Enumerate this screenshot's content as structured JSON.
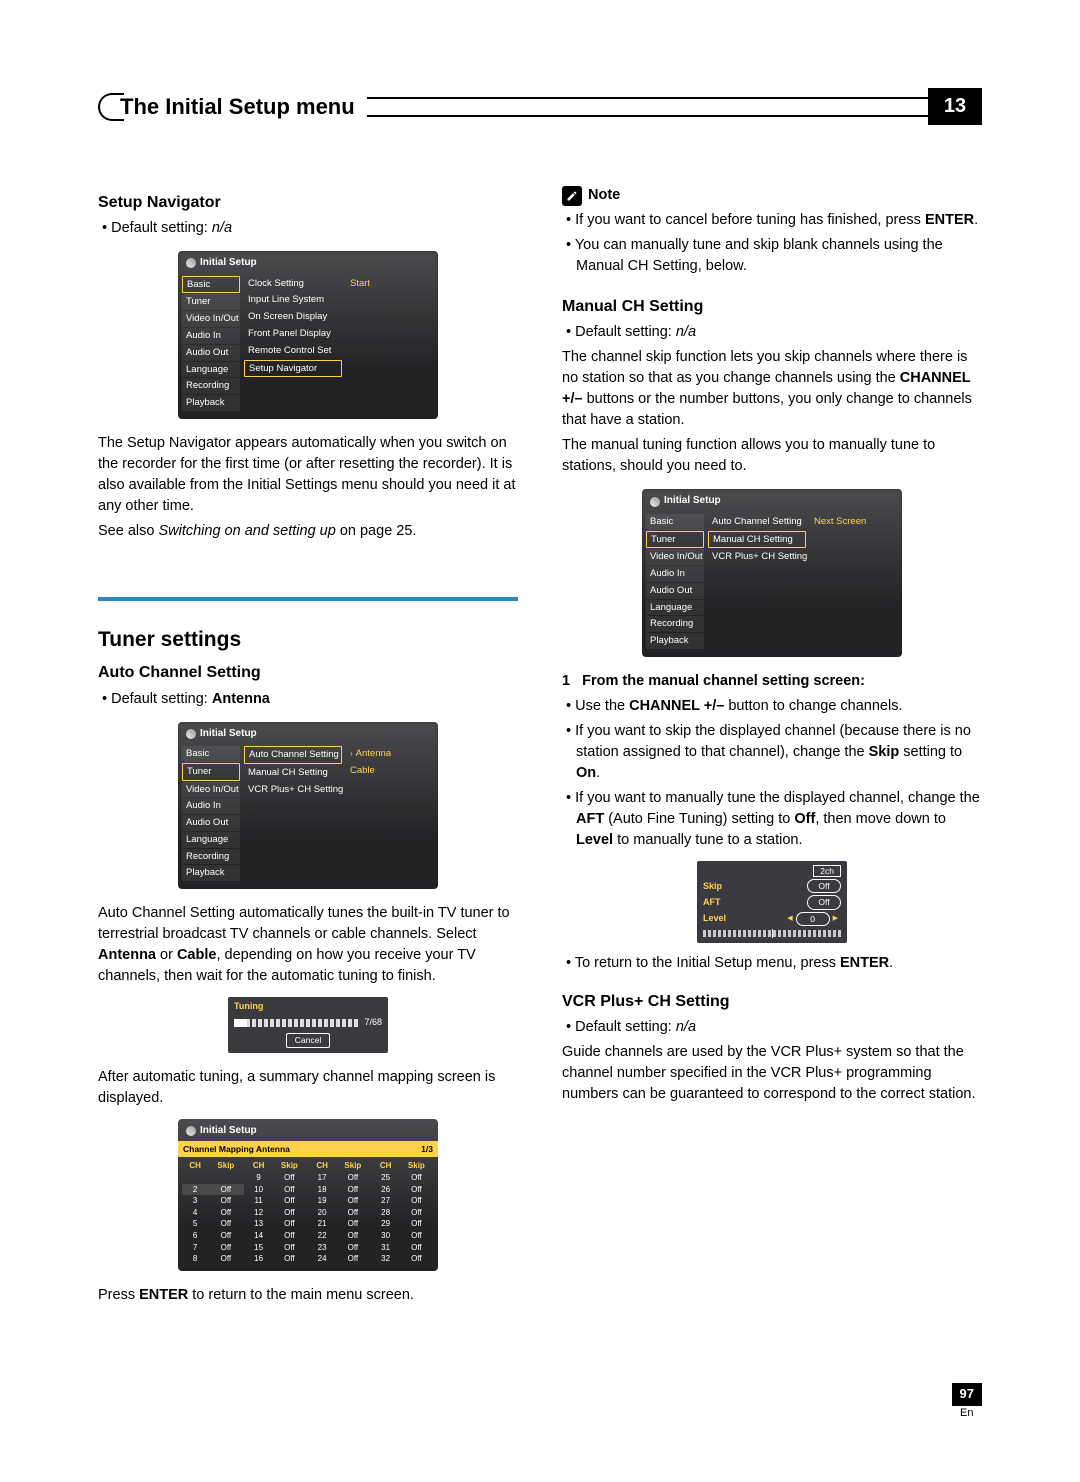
{
  "header": {
    "title": "The Initial Setup menu",
    "chapter": "13"
  },
  "left": {
    "setup_nav": {
      "heading": "Setup Navigator",
      "default_label": "Default setting: ",
      "default_value": "n/a",
      "osd": {
        "title": "Initial Setup",
        "col1": [
          "Basic",
          "Tuner",
          "Video In/Out",
          "Audio In",
          "Audio Out",
          "Language",
          "Recording",
          "Playback"
        ],
        "col2": [
          "Clock Setting",
          "Input Line System",
          "On Screen Display",
          "Front Panel Display",
          "Remote Control Set",
          "Setup Navigator"
        ],
        "col3": [
          "Start"
        ],
        "col1_sel_index": 0,
        "col2_sel_index": 5
      },
      "para1": "The Setup Navigator appears automatically when you switch on the recorder for the first time (or after resetting the recorder). It is also available from the Initial Settings menu should you need it at any other time.",
      "seealso_pre": "See also ",
      "seealso_ital": "Switching on and setting up",
      "seealso_post": " on page 25."
    },
    "tuner": {
      "heading": "Tuner settings",
      "auto": {
        "heading": "Auto Channel Setting",
        "default_label": "Default setting: ",
        "default_value": "Antenna",
        "osd": {
          "title": "Initial Setup",
          "col1": [
            "Basic",
            "Tuner",
            "Video In/Out",
            "Audio In",
            "Audio Out",
            "Language",
            "Recording",
            "Playback"
          ],
          "col2": [
            "Auto Channel Setting",
            "Manual CH Setting",
            "VCR Plus+ CH Setting"
          ],
          "col3": [
            "Antenna",
            "Cable"
          ],
          "col1_sel_index": 1,
          "col2_sel_index": 0,
          "col3_dot_index": 0
        },
        "para1_a": "Auto Channel Setting automatically tunes the built-in TV tuner to terrestrial broadcast TV channels or cable channels. Select ",
        "para1_b": "Antenna",
        "para1_c": " or ",
        "para1_d": "Cable",
        "para1_e": ", depending on how you receive your TV channels, then wait for the automatic tuning to finish.",
        "tuning": {
          "title": "Tuning",
          "count": "7/68",
          "cancel": "Cancel"
        },
        "para2": "After automatic tuning, a summary channel mapping screen is displayed.",
        "cm": {
          "osd_title": "Initial Setup",
          "bar_left": "Channel Mapping Antenna",
          "bar_right": "1/3",
          "th_ch": "CH",
          "th_skip": "Skip",
          "groups": [
            [
              [
                "2",
                "Off"
              ],
              [
                "3",
                "Off"
              ],
              [
                "4",
                "Off"
              ],
              [
                "5",
                "Off"
              ],
              [
                "6",
                "Off"
              ],
              [
                "7",
                "Off"
              ],
              [
                "8",
                "Off"
              ]
            ],
            [
              [
                "9",
                "Off"
              ],
              [
                "10",
                "Off"
              ],
              [
                "11",
                "Off"
              ],
              [
                "12",
                "Off"
              ],
              [
                "13",
                "Off"
              ],
              [
                "14",
                "Off"
              ],
              [
                "15",
                "Off"
              ],
              [
                "16",
                "Off"
              ]
            ],
            [
              [
                "17",
                "Off"
              ],
              [
                "18",
                "Off"
              ],
              [
                "19",
                "Off"
              ],
              [
                "20",
                "Off"
              ],
              [
                "21",
                "Off"
              ],
              [
                "22",
                "Off"
              ],
              [
                "23",
                "Off"
              ],
              [
                "24",
                "Off"
              ]
            ],
            [
              [
                "25",
                "Off"
              ],
              [
                "26",
                "Off"
              ],
              [
                "27",
                "Off"
              ],
              [
                "28",
                "Off"
              ],
              [
                "29",
                "Off"
              ],
              [
                "30",
                "Off"
              ],
              [
                "31",
                "Off"
              ],
              [
                "32",
                "Off"
              ]
            ]
          ]
        },
        "para3_a": "Press ",
        "para3_b": "ENTER",
        "para3_c": " to return to the main menu screen."
      }
    }
  },
  "right": {
    "note": {
      "label": "Note",
      "b1_a": "If you want to cancel before tuning has finished, press ",
      "b1_b": "ENTER",
      "b1_c": ".",
      "b2": "You can manually tune and skip blank channels using the Manual CH Setting, below."
    },
    "manual": {
      "heading": "Manual CH Setting",
      "default_label": "Default setting: ",
      "default_value": "n/a",
      "p1_a": "The channel skip function lets you skip channels where there is no station so that as you change channels using the ",
      "p1_b": "CHANNEL +/–",
      "p1_c": " buttons or the number buttons, you only change to channels that have a station.",
      "p2": "The manual tuning function allows you to manually tune to stations, should you need to.",
      "osd": {
        "title": "Initial Setup",
        "col1": [
          "Basic",
          "Tuner",
          "Video In/Out",
          "Audio In",
          "Audio Out",
          "Language",
          "Recording",
          "Playback"
        ],
        "col2": [
          "Auto Channel Setting",
          "Manual CH Setting",
          "VCR Plus+ CH Setting"
        ],
        "col3": [
          "Next Screen"
        ],
        "col1_sel_index": 1,
        "col2_sel_index": 1
      },
      "step1": "From the manual channel setting screen:",
      "s1_a": "Use the ",
      "s1_b": "CHANNEL +/–",
      "s1_c": " button to change channels.",
      "s2_a": "If you want to skip the displayed channel (because there is no station assigned to that channel), change the ",
      "s2_b": "Skip",
      "s2_c": " setting to ",
      "s2_d": "On",
      "s2_e": ".",
      "s3_a": "If you want to manually tune the displayed channel, change the ",
      "s3_b": "AFT",
      "s3_c": " (Auto Fine Tuning) setting to ",
      "s3_d": "Off",
      "s3_e": ", then move down to ",
      "s3_f": "Level",
      "s3_g": " to manually tune to a station.",
      "mt": {
        "ch": "2ch",
        "skip_l": "Skip",
        "skip_v": "Off",
        "aft_l": "AFT",
        "aft_v": "Off",
        "lvl_l": "Level",
        "lvl_v": "0"
      },
      "ret_a": "To return to the Initial Setup menu, press ",
      "ret_b": "ENTER",
      "ret_c": "."
    },
    "vcr": {
      "heading": "VCR Plus+ CH Setting",
      "default_label": "Default setting: ",
      "default_value": "n/a",
      "p": "Guide channels are used by the VCR Plus+ system so that the channel number specified in the VCR Plus+ programming numbers can be guaranteed to correspond to the correct station."
    }
  },
  "footer": {
    "page": "97",
    "lang": "En"
  }
}
